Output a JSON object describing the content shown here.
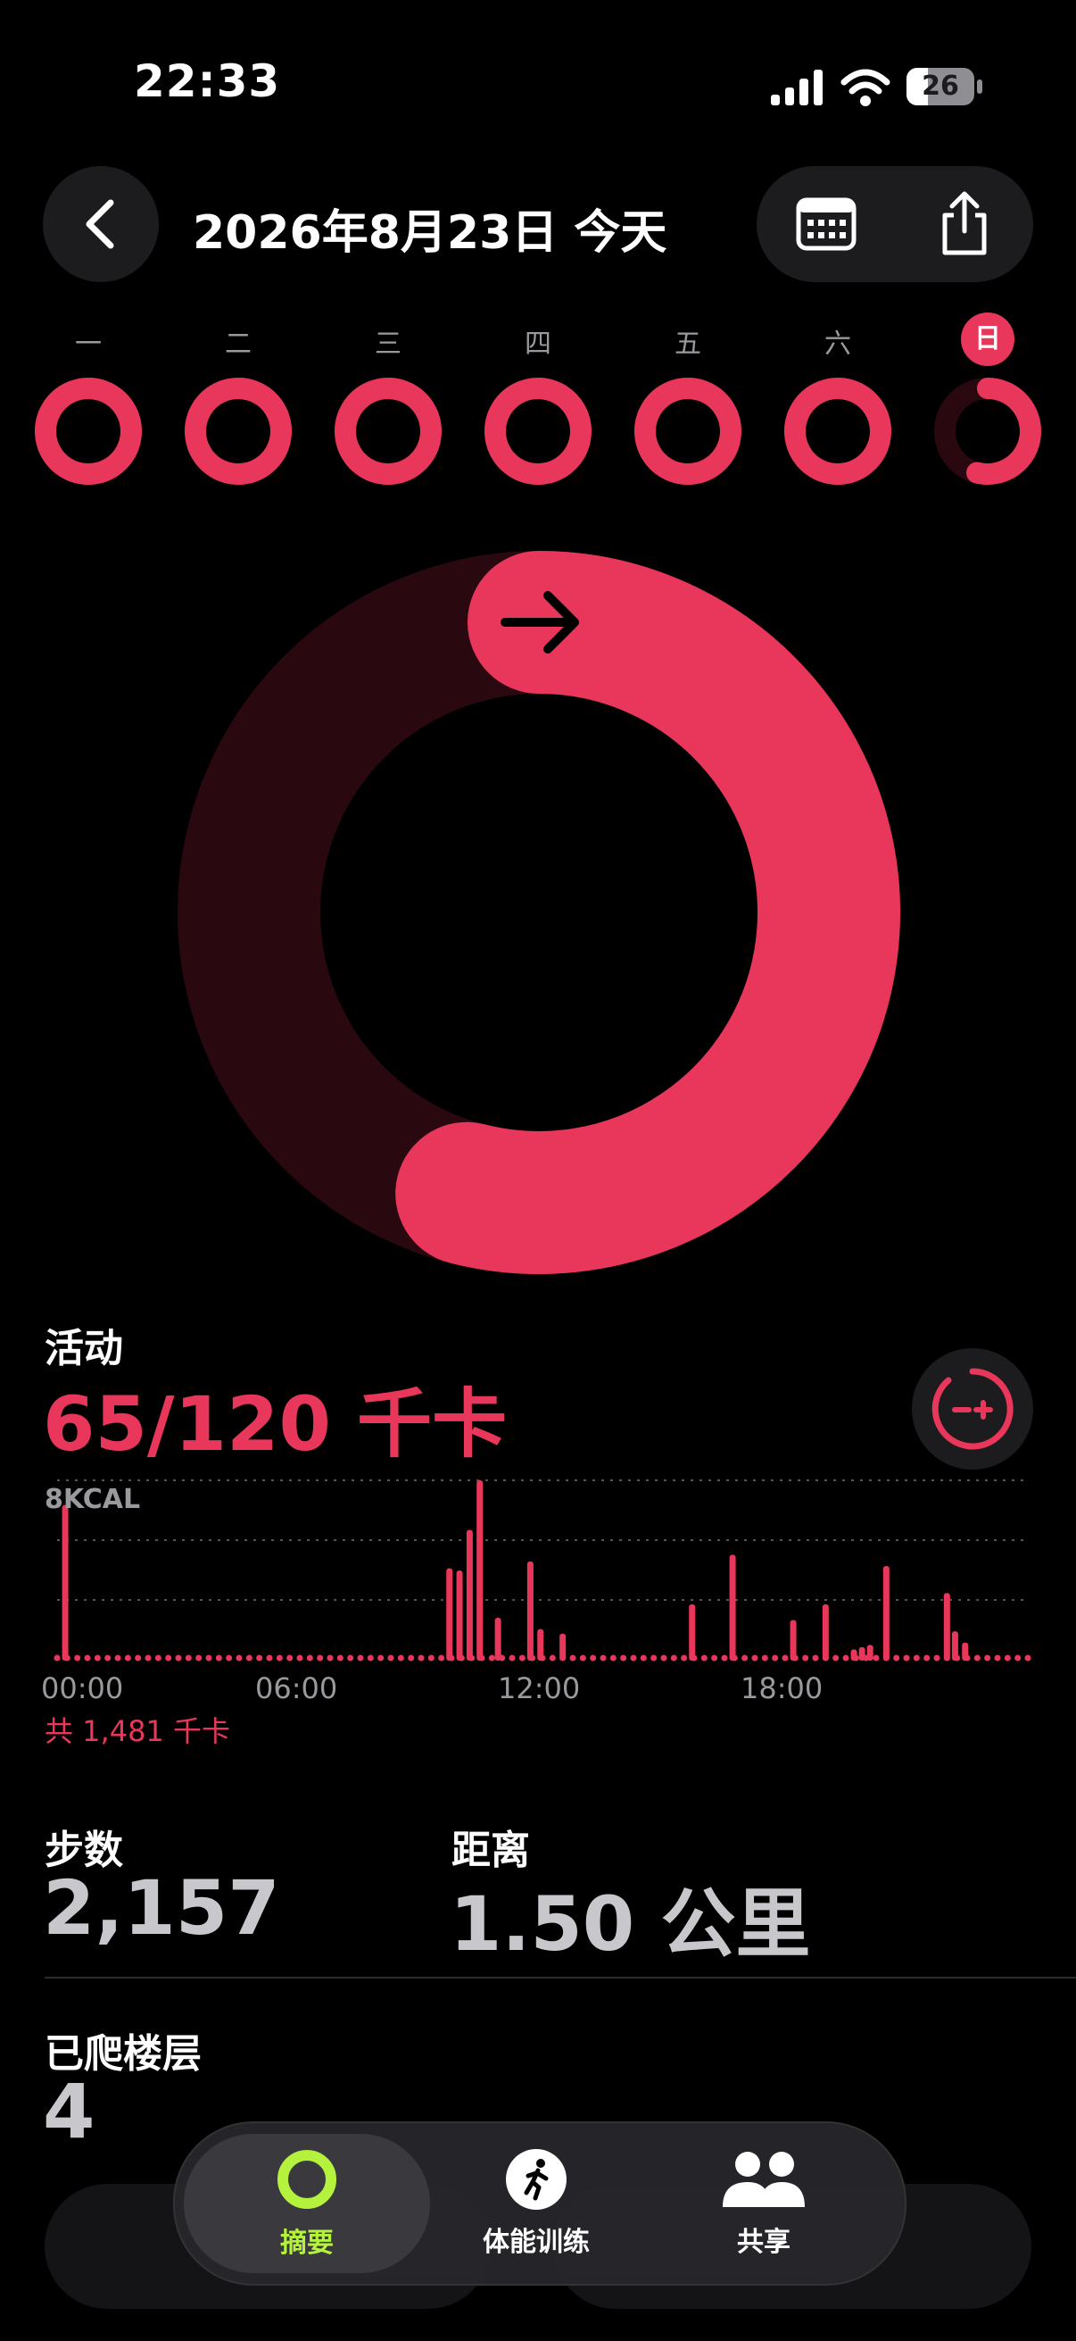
{
  "status_bar": {
    "time": "22:33",
    "battery": "26"
  },
  "header": {
    "title": "2026年8月23日 今天"
  },
  "week": {
    "days": [
      "一",
      "二",
      "三",
      "四",
      "五",
      "六",
      "日"
    ],
    "progress": [
      1.05,
      1.05,
      1.05,
      1.05,
      1.05,
      1.05,
      0.54
    ]
  },
  "main_ring": {
    "progress": 0.54,
    "color": "#e8375a",
    "track_color": "#2a0810"
  },
  "activity": {
    "label": "活动",
    "value": "65/120 千卡",
    "chart_scale": "8KCAL",
    "total": "共 1,481 千卡"
  },
  "chart_data": {
    "type": "bar",
    "ylabel": "8KCAL",
    "ylim": [
      0,
      8
    ],
    "x_ticks": [
      "00:00",
      "06:00",
      "12:00",
      "18:00"
    ],
    "bars": [
      {
        "hour": 0.2,
        "value": 6.9
      },
      {
        "hour": 9.7,
        "value": 4.1
      },
      {
        "hour": 9.95,
        "value": 4.0
      },
      {
        "hour": 10.2,
        "value": 5.8
      },
      {
        "hour": 10.45,
        "value": 8.0
      },
      {
        "hour": 10.9,
        "value": 1.9
      },
      {
        "hour": 11.7,
        "value": 4.4
      },
      {
        "hour": 11.95,
        "value": 1.4
      },
      {
        "hour": 12.5,
        "value": 1.2
      },
      {
        "hour": 15.7,
        "value": 2.5
      },
      {
        "hour": 16.7,
        "value": 4.7
      },
      {
        "hour": 18.2,
        "value": 1.8
      },
      {
        "hour": 19.0,
        "value": 2.5
      },
      {
        "hour": 19.7,
        "value": 0.5
      },
      {
        "hour": 19.9,
        "value": 0.6
      },
      {
        "hour": 20.1,
        "value": 0.7
      },
      {
        "hour": 20.5,
        "value": 4.2
      },
      {
        "hour": 22.0,
        "value": 3.0
      },
      {
        "hour": 22.2,
        "value": 1.3
      },
      {
        "hour": 22.45,
        "value": 0.8
      }
    ],
    "color": "#e8375a"
  },
  "stats": {
    "steps_label": "步数",
    "steps_value": "2,157",
    "distance_label": "距离",
    "distance_value": "1.50 公里",
    "floors_label": "已爬楼层",
    "floors_value": "4"
  },
  "tabbar": {
    "tabs": [
      {
        "label": "摘要"
      },
      {
        "label": "体能训练"
      },
      {
        "label": "共享"
      }
    ]
  },
  "colors": {
    "accent": "#e8375a",
    "summary_green": "#b4f23e"
  }
}
